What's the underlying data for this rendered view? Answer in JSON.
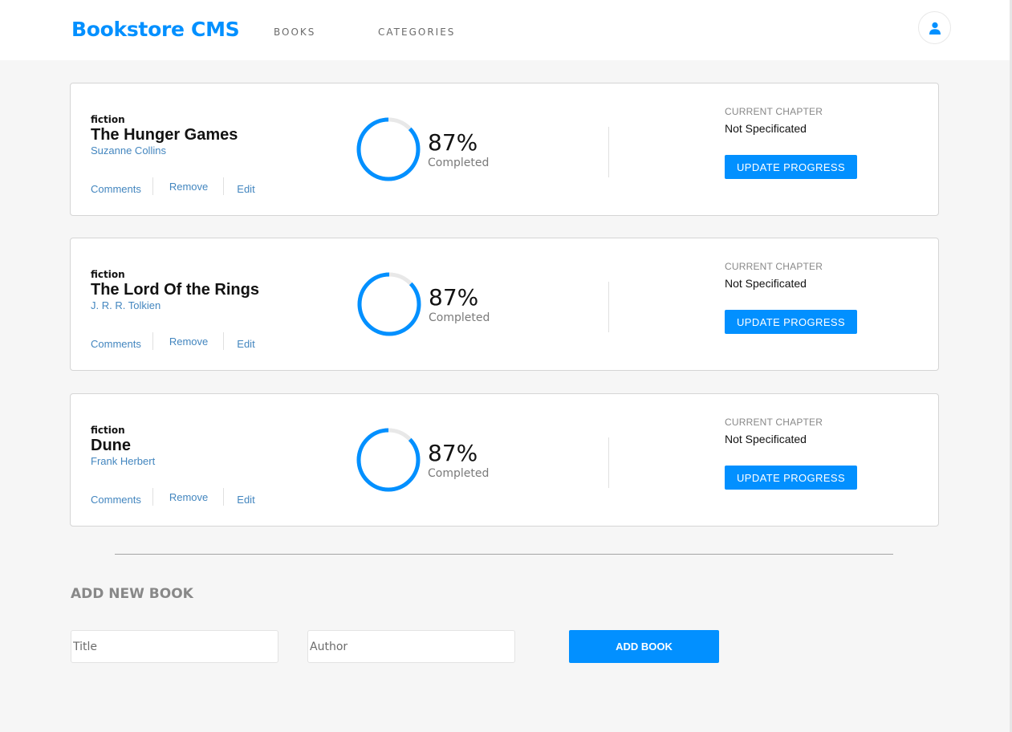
{
  "header": {
    "brand": "Bookstore CMS",
    "nav": [
      "BOOKS",
      "CATEGORIES"
    ],
    "avatar_icon": "user-icon"
  },
  "colors": {
    "accent": "#0290ff",
    "link": "#4386bf",
    "progress_track": "#e8e8e8"
  },
  "books": [
    {
      "genre": "fiction",
      "title": "The Hunger Games",
      "author": "Suzanne Collins",
      "actions": [
        "Comments",
        "Remove",
        "Edit"
      ],
      "progress_fraction": 0.87,
      "percent_text": "87%",
      "completed_label": "Completed",
      "chapter_label": "CURRENT CHAPTER",
      "chapter_value": "Not Specificated",
      "update_label": "UPDATE PROGRESS"
    },
    {
      "genre": "fiction",
      "title": "The Lord Of the Rings",
      "author": "J. R. R. Tolkien",
      "actions": [
        "Comments",
        "Remove",
        "Edit"
      ],
      "progress_fraction": 0.87,
      "percent_text": "87%",
      "completed_label": "Completed",
      "chapter_label": "CURRENT CHAPTER",
      "chapter_value": "Not Specificated",
      "update_label": "UPDATE PROGRESS"
    },
    {
      "genre": "fiction",
      "title": "Dune",
      "author": "Frank Herbert",
      "actions": [
        "Comments",
        "Remove",
        "Edit"
      ],
      "progress_fraction": 0.87,
      "percent_text": "87%",
      "completed_label": "Completed",
      "chapter_label": "CURRENT CHAPTER",
      "chapter_value": "Not Specificated",
      "update_label": "UPDATE PROGRESS"
    }
  ],
  "add_form": {
    "heading": "ADD NEW BOOK",
    "title_placeholder": "Title",
    "author_placeholder": "Author",
    "button_label": "ADD BOOK"
  }
}
